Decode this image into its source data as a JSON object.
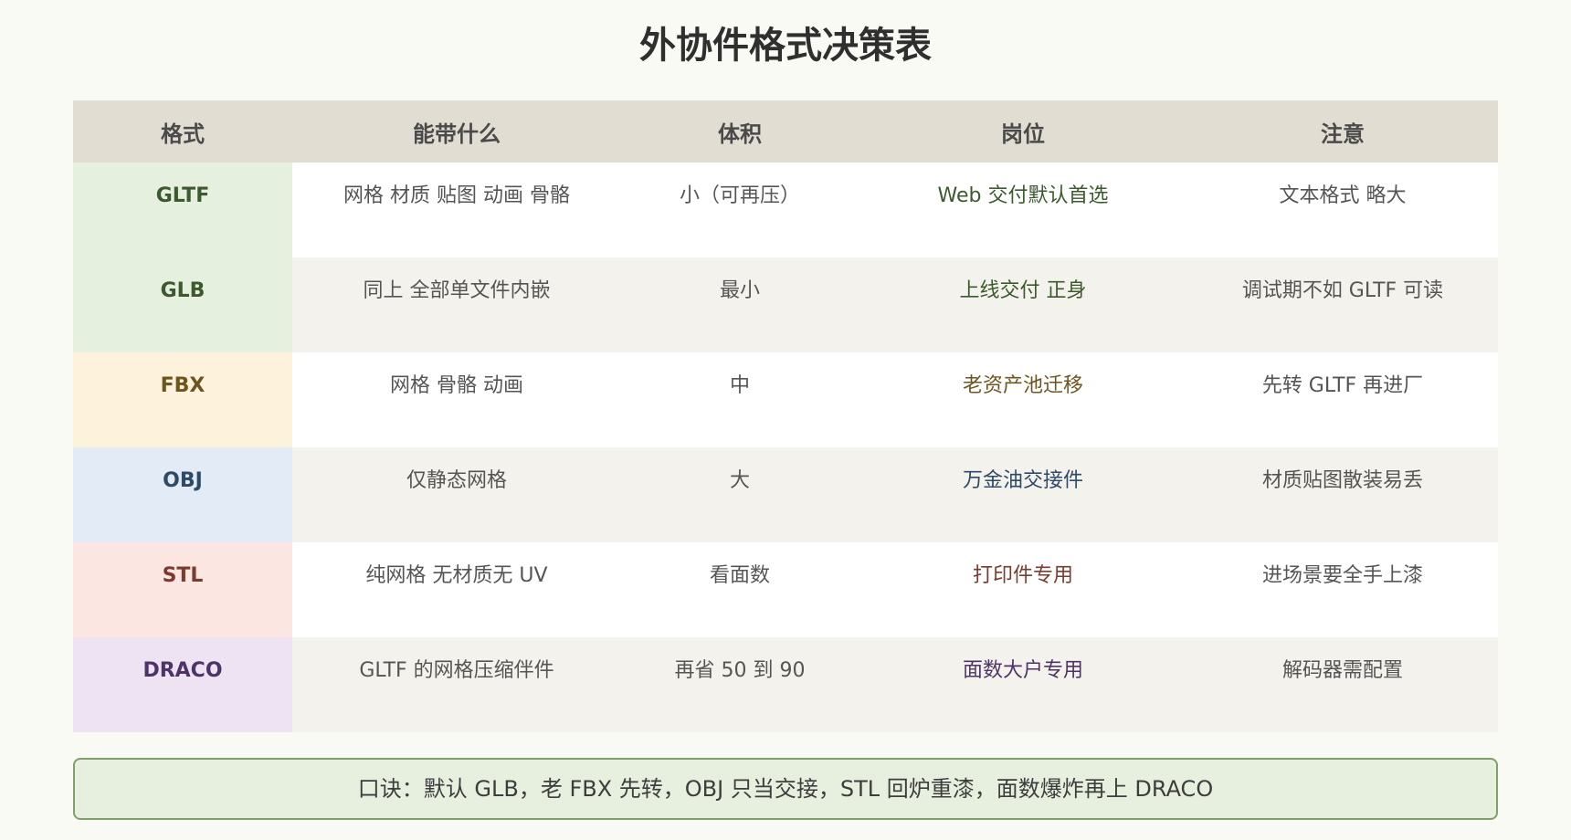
{
  "title": "外协件格式决策表",
  "headers": {
    "format": "格式",
    "contents": "能带什么",
    "size": "体积",
    "role": "岗位",
    "notes": "注意"
  },
  "rows": [
    {
      "format": "GLTF",
      "contents": "网格 材质 贴图 动画 骨骼",
      "size": "小（可再压）",
      "role": "Web 交付默认首选",
      "notes": "文本格式 略大",
      "format_bg": "#e6f0df",
      "format_color": "#3c5a2e",
      "role_color": "#3c5a2e"
    },
    {
      "format": "GLB",
      "contents": "同上 全部单文件内嵌",
      "size": "最小",
      "role": "上线交付 正身",
      "notes": "调试期不如 GLTF 可读",
      "format_bg": "#e6f0df",
      "format_color": "#3c5a2e",
      "role_color": "#3c5a2e"
    },
    {
      "format": "FBX",
      "contents": "网格 骨骼 动画",
      "size": "中",
      "role": "老资产池迁移",
      "notes": "先转 GLTF 再进厂",
      "format_bg": "#fdf2dc",
      "format_color": "#6e5520",
      "role_color": "#6e5520"
    },
    {
      "format": "OBJ",
      "contents": "仅静态网格",
      "size": "大",
      "role": "万金油交接件",
      "notes": "材质贴图散装易丢",
      "format_bg": "#e3ebf6",
      "format_color": "#2e4a66",
      "role_color": "#2e4a66"
    },
    {
      "format": "STL",
      "contents": "纯网格 无材质无 UV",
      "size": "看面数",
      "role": "打印件专用",
      "notes": "进场景要全手上漆",
      "format_bg": "#fce6e1",
      "format_color": "#7a3c30",
      "role_color": "#7a3c30"
    },
    {
      "format": "DRACO",
      "contents": "GLTF 的网格压缩伴件",
      "size": "再省 50 到 90",
      "role": "面数大户专用",
      "notes": "解码器需配置",
      "format_bg": "#ede3f3",
      "format_color": "#4e3466",
      "role_color": "#4e3466"
    }
  ],
  "callout": "口诀：默认 GLB，老 FBX 先转，OBJ 只当交接，STL 回炉重漆，面数爆炸再上 DRACO"
}
